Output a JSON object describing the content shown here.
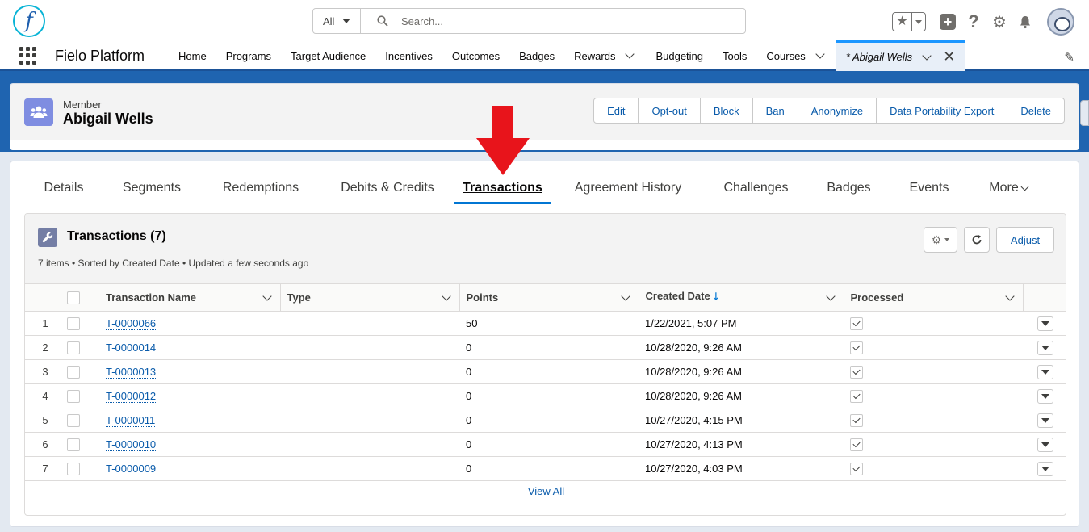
{
  "header": {
    "logo_text": "f",
    "search_scope": "All",
    "search_placeholder": "Search..."
  },
  "nav": {
    "app_name": "Fielo Platform",
    "items": [
      {
        "label": "Home",
        "has_menu": false
      },
      {
        "label": "Programs",
        "has_menu": false
      },
      {
        "label": "Target Audience",
        "has_menu": false
      },
      {
        "label": "Incentives",
        "has_menu": false
      },
      {
        "label": "Outcomes",
        "has_menu": false
      },
      {
        "label": "Badges",
        "has_menu": false
      },
      {
        "label": "Rewards",
        "has_menu": true
      },
      {
        "label": "Budgeting",
        "has_menu": false
      },
      {
        "label": "Tools",
        "has_menu": false
      },
      {
        "label": "Courses",
        "has_menu": true
      }
    ],
    "active_tab": "* Abigail Wells"
  },
  "record": {
    "object_type": "Member",
    "name": "Abigail Wells",
    "actions": [
      "Edit",
      "Opt-out",
      "Block",
      "Ban",
      "Anonymize",
      "Data Portability Export",
      "Delete"
    ]
  },
  "tabs": [
    {
      "label": "Details",
      "width": 98
    },
    {
      "label": "Segments",
      "width": 120
    },
    {
      "label": "Redemptions",
      "width": 150
    },
    {
      "label": "Debits & Credits",
      "width": 164
    },
    {
      "label": "Transactions",
      "width": 121,
      "active": true
    },
    {
      "label": "Agreement History",
      "width": 190
    },
    {
      "label": "Challenges",
      "width": 127
    },
    {
      "label": "Badges",
      "width": 103
    },
    {
      "label": "Events",
      "width": 96
    },
    {
      "label": "More",
      "width": 100
    }
  ],
  "related_list": {
    "title": "Transactions (7)",
    "subtitle": "7 items • Sorted by Created Date • Updated a few seconds ago",
    "adjust_label": "Adjust",
    "columns": {
      "name": "Transaction Name",
      "type": "Type",
      "points": "Points",
      "created": "Created Date",
      "processed": "Processed"
    },
    "rows": [
      {
        "num": "1",
        "name": "T-0000066",
        "type": "",
        "points": "50",
        "created": "1/22/2021, 5:07 PM",
        "processed": true
      },
      {
        "num": "2",
        "name": "T-0000014",
        "type": "",
        "points": "0",
        "created": "10/28/2020, 9:26 AM",
        "processed": true
      },
      {
        "num": "3",
        "name": "T-0000013",
        "type": "",
        "points": "0",
        "created": "10/28/2020, 9:26 AM",
        "processed": true
      },
      {
        "num": "4",
        "name": "T-0000012",
        "type": "",
        "points": "0",
        "created": "10/28/2020, 9:26 AM",
        "processed": true
      },
      {
        "num": "5",
        "name": "T-0000011",
        "type": "",
        "points": "0",
        "created": "10/27/2020, 4:15 PM",
        "processed": true
      },
      {
        "num": "6",
        "name": "T-0000010",
        "type": "",
        "points": "0",
        "created": "10/27/2020, 4:13 PM",
        "processed": true
      },
      {
        "num": "7",
        "name": "T-0000009",
        "type": "",
        "points": "0",
        "created": "10/27/2020, 4:03 PM",
        "processed": true
      }
    ],
    "view_all": "View All"
  },
  "annotation": {
    "arrow_color": "#e8141b"
  }
}
